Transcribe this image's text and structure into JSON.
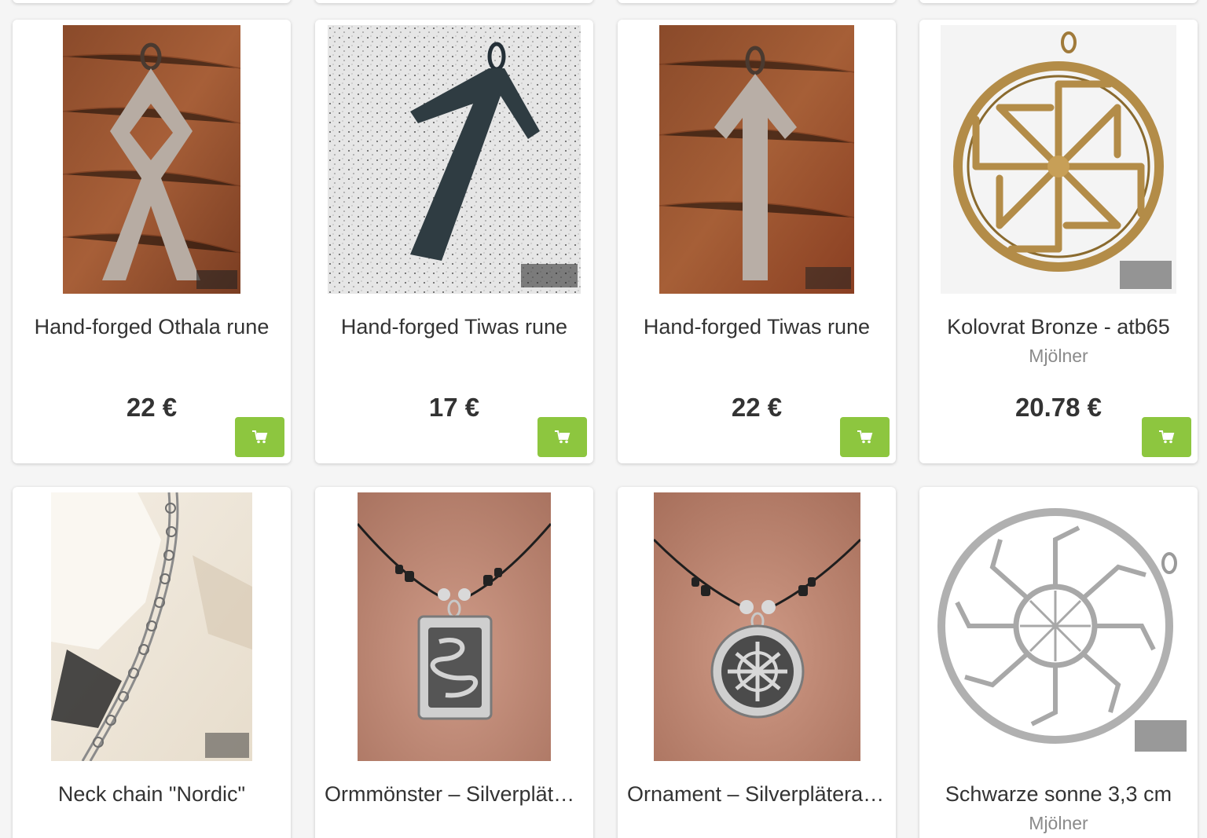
{
  "products": [
    {
      "title": "Hand-forged Othala rune",
      "vendor": "",
      "price": "22 €",
      "image": "othala-rune-pendant"
    },
    {
      "title": "Hand-forged Tiwas rune",
      "vendor": "",
      "price": "17 €",
      "image": "tiwas-rune-dark-on-granite"
    },
    {
      "title": "Hand-forged Tiwas rune",
      "vendor": "",
      "price": "22 €",
      "image": "tiwas-rune-steel"
    },
    {
      "title": "Kolovrat Bronze - atb65",
      "vendor": "Mjölner",
      "price": "20.78 €",
      "image": "kolovrat-bronze-pendant"
    },
    {
      "title": "Neck chain \"Nordic\"",
      "vendor": "",
      "price": "",
      "image": "neck-chain-skull"
    },
    {
      "title": "Ormmönster – Silverpläterat hänge",
      "vendor": "",
      "price": "",
      "image": "serpent-pattern-pendant"
    },
    {
      "title": "Ornament – Silverpläterat hänge",
      "vendor": "",
      "price": "",
      "image": "knot-ornament-pendant"
    },
    {
      "title": "Schwarze sonne 3,3 cm",
      "vendor": "Mjölner",
      "price": "",
      "image": "black-sun-pendant"
    }
  ],
  "cart_icon": "cart-icon",
  "colors": {
    "accent_green": "#8dc63f",
    "price_text": "#333333",
    "vendor_text": "#8a8a8a"
  }
}
